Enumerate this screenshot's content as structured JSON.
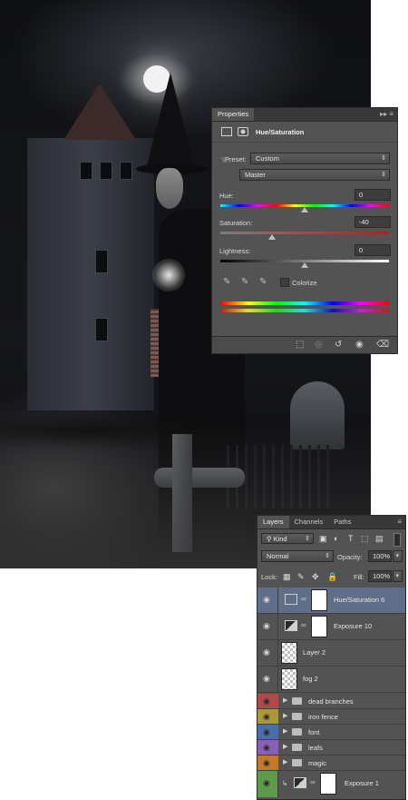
{
  "properties": {
    "tab": "Properties",
    "header_title": "Hue/Saturation",
    "preset_label": "Preset:",
    "preset_value": "Custom",
    "channel_value": "Master",
    "hue_label": "Hue:",
    "hue_value": "0",
    "saturation_label": "Saturation:",
    "saturation_value": "-40",
    "lightness_label": "Lightness:",
    "lightness_value": "0",
    "colorize_label": "Colorize",
    "tab_controls": "▸▸",
    "menu_glyph": "≡"
  },
  "layers": {
    "tabs": [
      "Layers",
      "Channels",
      "Paths"
    ],
    "kind_label": "Kind",
    "blend_mode": "Normal",
    "opacity_label": "Opacity:",
    "opacity_value": "100%",
    "lock_label": "Lock:",
    "fill_label": "Fill:",
    "fill_value": "100%",
    "items": [
      {
        "name": "Hue/Saturation 6",
        "type": "adjustment"
      },
      {
        "name": "Exposure 10",
        "type": "adjustment"
      },
      {
        "name": "Layer 2",
        "type": "pixel"
      },
      {
        "name": "fog 2",
        "type": "pixel"
      },
      {
        "name": "dead branches",
        "type": "group",
        "color": "#b04a4a"
      },
      {
        "name": "iron fence",
        "type": "group",
        "color": "#a89a36"
      },
      {
        "name": "font",
        "type": "group",
        "color": "#4a6ea8"
      },
      {
        "name": "leafs",
        "type": "group",
        "color": "#8a5fb5"
      },
      {
        "name": "magic",
        "type": "group",
        "color": "#c07a2a"
      },
      {
        "name": "Exposure 1",
        "type": "adjustment",
        "color": "#5d9a4a"
      }
    ]
  },
  "colors": {
    "panel_bg": "#535353",
    "selected_row": "#5f6f8a"
  }
}
